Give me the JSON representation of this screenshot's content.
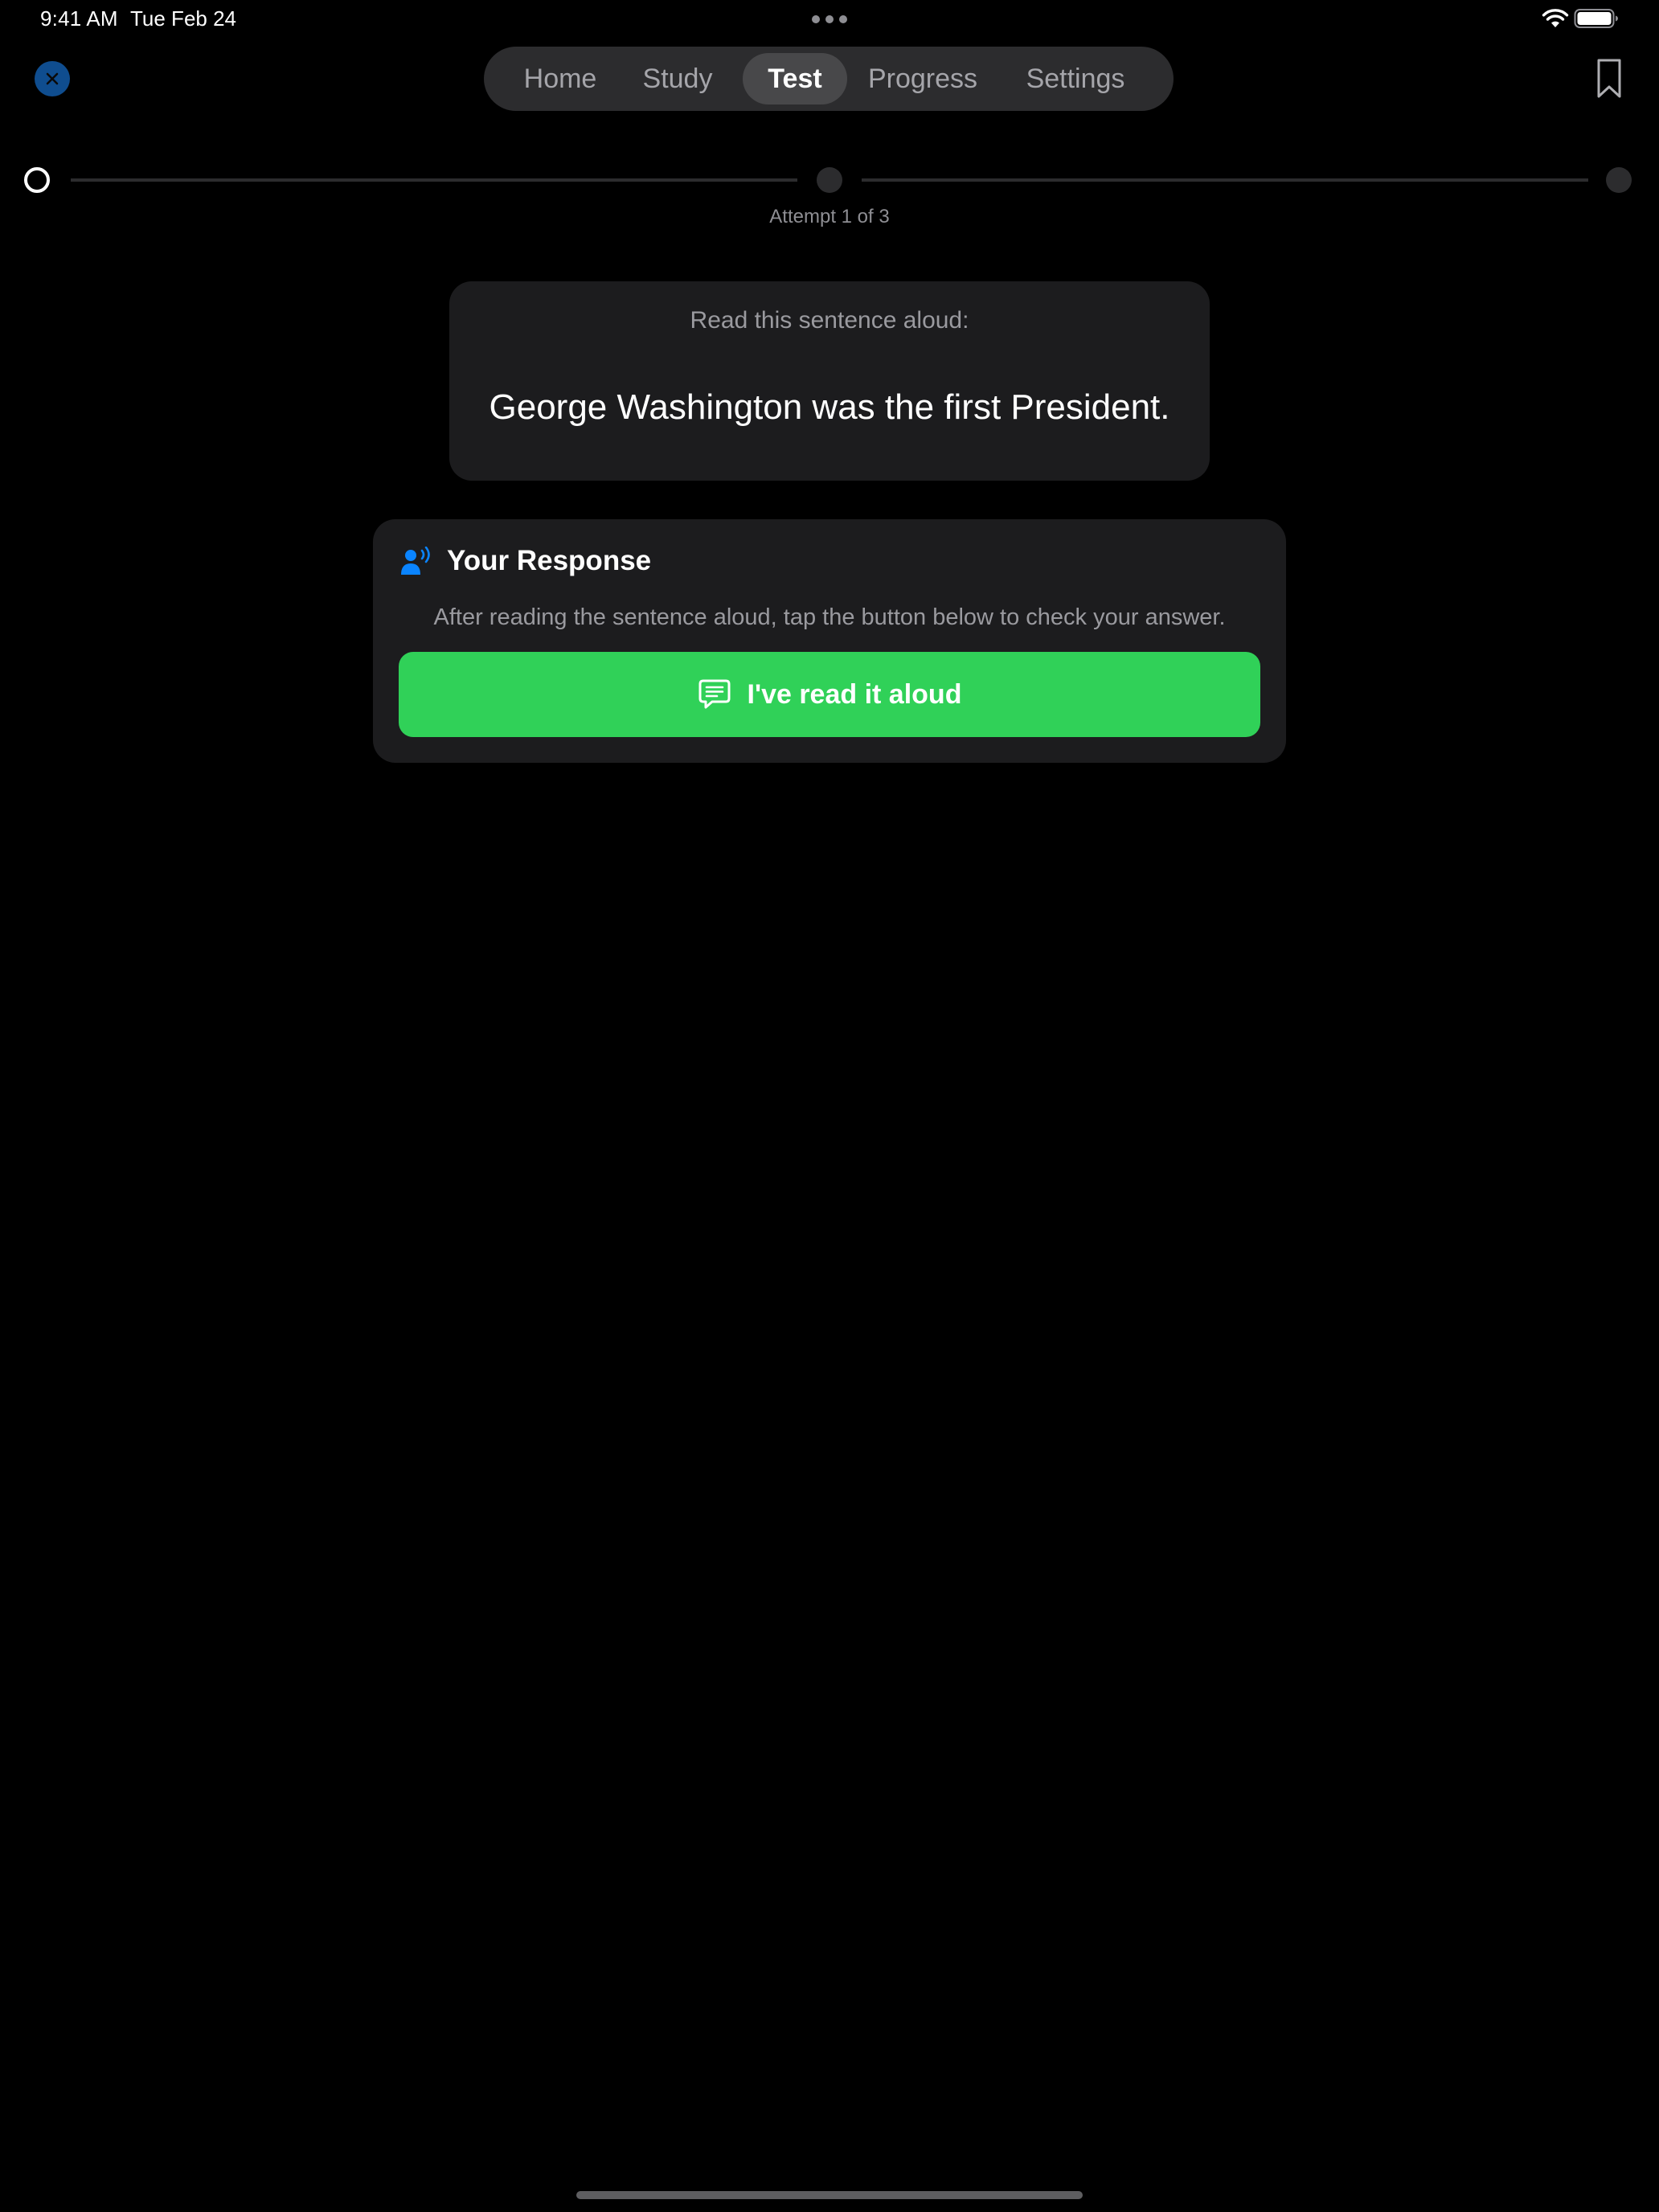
{
  "status_bar": {
    "time": "9:41 AM",
    "date": "Tue Feb 24",
    "wifi_icon": "wifi-icon",
    "battery_icon": "battery-icon"
  },
  "nav": {
    "close_icon": "close-icon",
    "bookmark_icon": "bookmark-icon",
    "tabs": [
      {
        "label": "Home",
        "active": false
      },
      {
        "label": "Study",
        "active": false
      },
      {
        "label": "Test",
        "active": true
      },
      {
        "label": "Progress",
        "active": false
      },
      {
        "label": "Settings",
        "active": false
      }
    ]
  },
  "progress": {
    "current_step": 1,
    "total_steps": 3,
    "attempt_label": "Attempt 1 of 3"
  },
  "prompt": {
    "instruction": "Read this sentence aloud:",
    "sentence": "George Washington was the first President."
  },
  "response": {
    "icon": "person-speaking-icon",
    "title": "Your Response",
    "help_text": "After reading the sentence aloud, tap the button below to check your answer.",
    "button_icon": "chat-bubble-icon",
    "button_label": "I've read it aloud"
  },
  "colors": {
    "background": "#000000",
    "card": "#1c1c1e",
    "accent_blue": "#0a84ff",
    "accent_green": "#30d158",
    "secondary_text": "#9a9a9f"
  }
}
